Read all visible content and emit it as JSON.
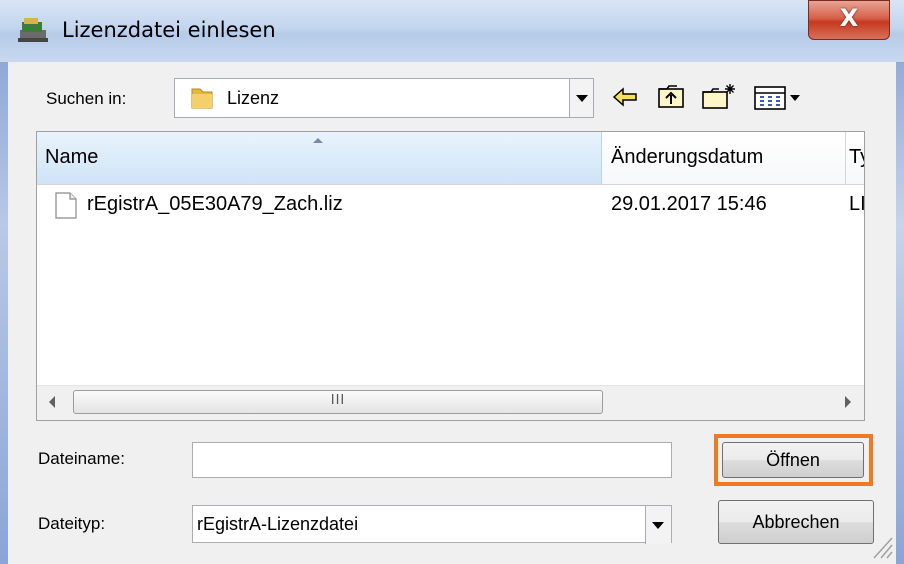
{
  "window": {
    "title": "Lizenzdatei einlesen",
    "close_glyph": "X",
    "title_icon": "app-icon"
  },
  "lookin": {
    "label": "Suchen in:",
    "value": "Lizenz",
    "icon": "folder-icon"
  },
  "toolbar": {
    "icons": [
      "back-arrow-icon",
      "up-folder-icon",
      "new-folder-icon",
      "view-menu-icon"
    ]
  },
  "list": {
    "columns": [
      "Name",
      "Änderungsdatum",
      "Ty"
    ],
    "sort_column": "Name",
    "rows": [
      {
        "name": "rEgistrA_05E30A79_Zach.liz",
        "date": "29.01.2017 15:46",
        "type": "LI"
      }
    ],
    "scroll_grip": "III"
  },
  "filename": {
    "label": "Dateiname:",
    "value": ""
  },
  "filetype": {
    "label": "Dateityp:",
    "value": "rEgistrA-Lizenzdatei"
  },
  "buttons": {
    "open": "Öffnen",
    "cancel": "Abbrechen"
  },
  "colors": {
    "highlight": "#f07a23",
    "titlebar": "#c2d5ee",
    "close": "#c6391f"
  }
}
